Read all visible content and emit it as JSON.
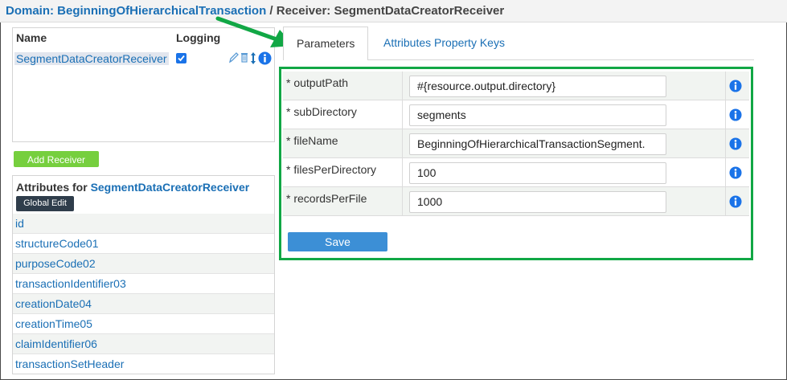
{
  "header": {
    "domain_label": "Domain:",
    "domain_name": "BeginningOfHierarchicalTransaction",
    "separator": "/",
    "receiver_label": "Receiver:",
    "receiver_name": "SegmentDataCreatorReceiver"
  },
  "receivers": {
    "col_name": "Name",
    "col_logging": "Logging",
    "rows": [
      {
        "name": "SegmentDataCreatorReceiver",
        "logging": true
      }
    ],
    "add_button": "Add Receiver"
  },
  "attributes": {
    "title_prefix": "Attributes for",
    "title_receiver": "SegmentDataCreatorReceiver",
    "global_edit": "Global Edit",
    "items": [
      "id",
      "structureCode01",
      "purposeCode02",
      "transactionIdentifier03",
      "creationDate04",
      "creationTime05",
      "claimIdentifier06",
      "transactionSetHeader"
    ]
  },
  "tabs": [
    {
      "label": "Parameters",
      "active": true
    },
    {
      "label": "Attributes Property Keys",
      "active": false
    }
  ],
  "params": [
    {
      "label": "* outputPath",
      "value": "#{resource.output.directory}"
    },
    {
      "label": "* subDirectory",
      "value": "segments"
    },
    {
      "label": "* fileName",
      "value": "BeginningOfHierarchicalTransactionSegment."
    },
    {
      "label": "* filesPerDirectory",
      "value": "100"
    },
    {
      "label": "* recordsPerFile",
      "value": "1000"
    }
  ],
  "save_button": "Save",
  "colors": {
    "link_blue": "#1a6fb5",
    "highlight_green": "#11a745",
    "add_green": "#76cf3e",
    "save_blue": "#3c8fd6",
    "global_edit_dark": "#2f3d4b",
    "info_blue": "#1a73e8"
  }
}
